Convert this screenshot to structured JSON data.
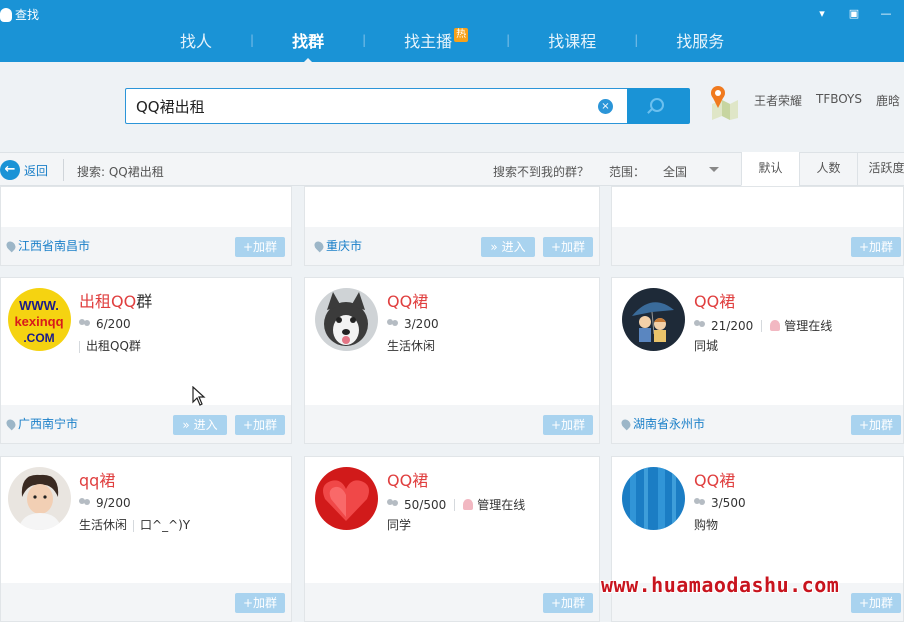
{
  "app": {
    "title": "查找"
  },
  "nav": {
    "tabs": [
      {
        "label": "找人",
        "active": false
      },
      {
        "label": "找群",
        "active": true
      },
      {
        "label": "找主播",
        "active": false,
        "badge": "热"
      },
      {
        "label": "找课程",
        "active": false
      },
      {
        "label": "找服务",
        "active": false
      }
    ]
  },
  "search": {
    "value": "QQ裙出租",
    "clear_glyph": "×",
    "hot_words": [
      "王者荣耀",
      "TFBOYS",
      "鹿晗"
    ]
  },
  "filter": {
    "back_label": "返回",
    "back_glyph": "←",
    "search_summary": "搜索: QQ裙出租",
    "not_found": "搜索不到我的群？",
    "range_label": "范围：",
    "range_value": "全国",
    "sort_tabs": [
      "默认",
      "人数",
      "活跃度"
    ],
    "active_sort": "默认"
  },
  "buttons": {
    "join": "+加群",
    "enter": "» 进入"
  },
  "top_row": [
    {
      "location": "江西省南昌市",
      "has_enter": false
    },
    {
      "location": "重庆市",
      "has_enter": true
    },
    {
      "location": "",
      "has_enter": false
    }
  ],
  "groups": [
    {
      "name_red": "出租QQ",
      "name_plain": "群",
      "members": "6/200",
      "admin_online": "",
      "tags": [
        "出租QQ群"
      ],
      "tag_leading_bar": true,
      "location": "广西南宁市",
      "has_enter": true,
      "avatar": "kexinqq-logo"
    },
    {
      "name_red": "QQ裙",
      "name_plain": "",
      "members": "3/200",
      "admin_online": "",
      "tags": [
        "生活休闲"
      ],
      "tag_leading_bar": false,
      "location": "",
      "has_enter": false,
      "avatar": "husky-puppy"
    },
    {
      "name_red": "QQ裙",
      "name_plain": "",
      "members": "21/200",
      "admin_online": "管理在线",
      "tags": [
        "同城"
      ],
      "tag_leading_bar": false,
      "location": "湖南省永州市",
      "has_enter": false,
      "avatar": "anime-couple"
    },
    {
      "name_red": "qq裙",
      "name_plain": "",
      "members": "9/200",
      "admin_online": "",
      "tags": [
        "生活休闲",
        "口^_^)Y"
      ],
      "tag_leading_bar": false,
      "location": "",
      "has_enter": false,
      "avatar": "young-man"
    },
    {
      "name_red": "QQ裙",
      "name_plain": "",
      "members": "50/500",
      "admin_online": "管理在线",
      "tags": [
        "同学"
      ],
      "tag_leading_bar": false,
      "location": "",
      "has_enter": false,
      "avatar": "red-heart"
    },
    {
      "name_red": "QQ裙",
      "name_plain": "",
      "members": "3/500",
      "admin_online": "",
      "tags": [
        "购物"
      ],
      "tag_leading_bar": false,
      "location": "",
      "has_enter": false,
      "avatar": "blue-circle"
    }
  ],
  "watermark": "www.huamaodashu.com",
  "colors": {
    "brand_blue": "#1a93d6",
    "name_red": "#e04040",
    "link_blue": "#1a7fc8",
    "button_light_blue": "#a9d3ef",
    "watermark_red": "#c8141e"
  }
}
